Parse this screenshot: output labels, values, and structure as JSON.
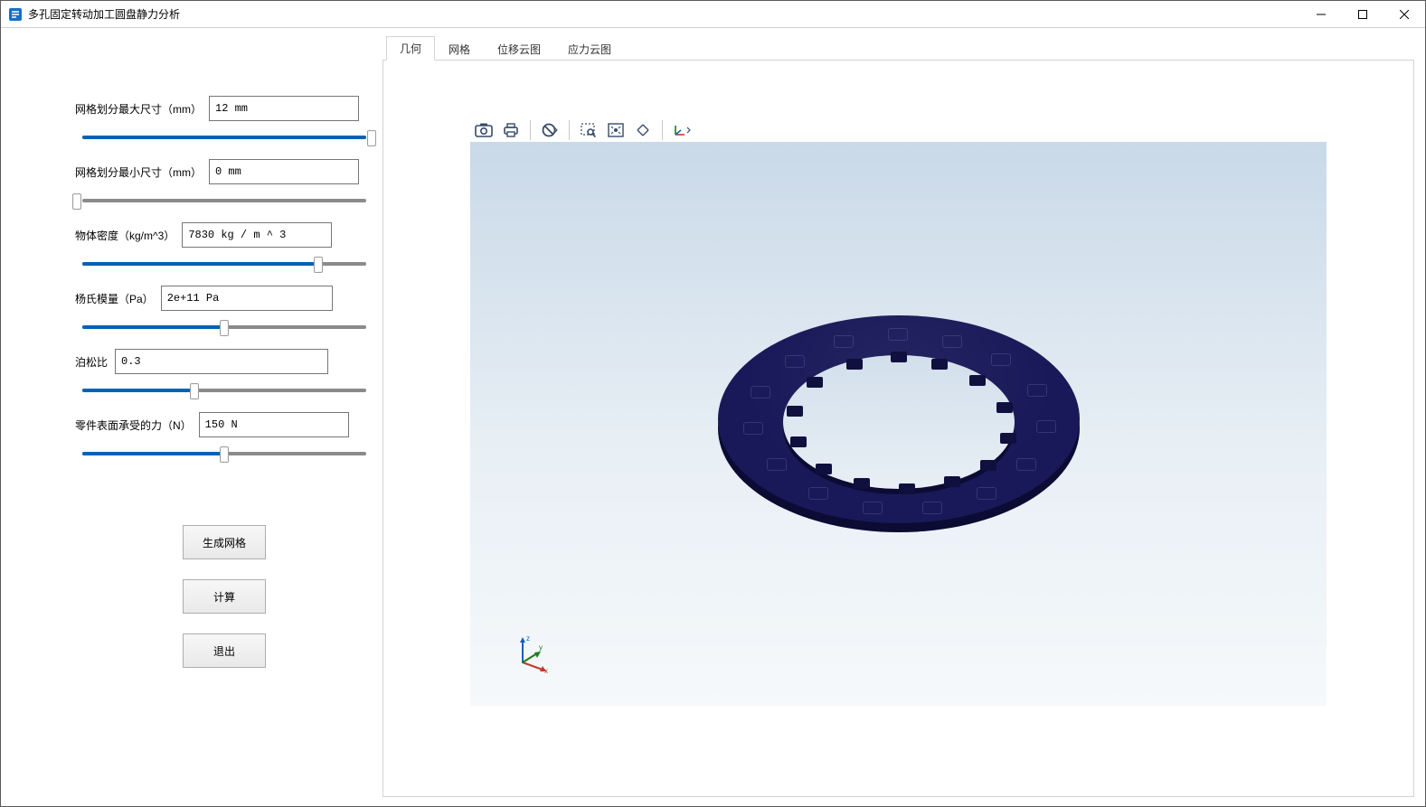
{
  "window": {
    "title": "多孔固定转动加工圆盘静力分析"
  },
  "params": {
    "mesh_max": {
      "label": "网格划分最大尺寸（mm）",
      "value": "12 mm",
      "slider_pct": 100
    },
    "mesh_min": {
      "label": "网格划分最小尺寸（mm）",
      "value": "0 mm",
      "slider_pct": 0
    },
    "density": {
      "label": "物体密度（kg/m^3）",
      "value": "7830 kg / m ^ 3",
      "slider_pct": 82
    },
    "youngs": {
      "label": "杨氏模量（Pa）",
      "value": "2e+11 Pa",
      "slider_pct": 50
    },
    "poisson": {
      "label": "泊松比",
      "value": "0.3",
      "slider_pct": 40
    },
    "force": {
      "label": "零件表面承受的力（N）",
      "value": "150 N",
      "slider_pct": 50
    }
  },
  "buttons": {
    "generate_mesh": "生成网格",
    "compute": "计算",
    "exit": "退出"
  },
  "tabs": {
    "geometry": "几何",
    "mesh": "网格",
    "disp_contour": "位移云图",
    "stress_contour": "应力云图",
    "active": "geometry"
  },
  "viewer_toolbar": {
    "screenshot": "screenshot",
    "print": "print",
    "cancel_selection": "cancel-selection",
    "zoom_window": "zoom-window",
    "fit_view": "fit-view",
    "reset_camera": "reset-camera",
    "axes_toggle": "axes-toggle"
  },
  "triad": {
    "x": "x",
    "y": "y",
    "z": "z"
  }
}
